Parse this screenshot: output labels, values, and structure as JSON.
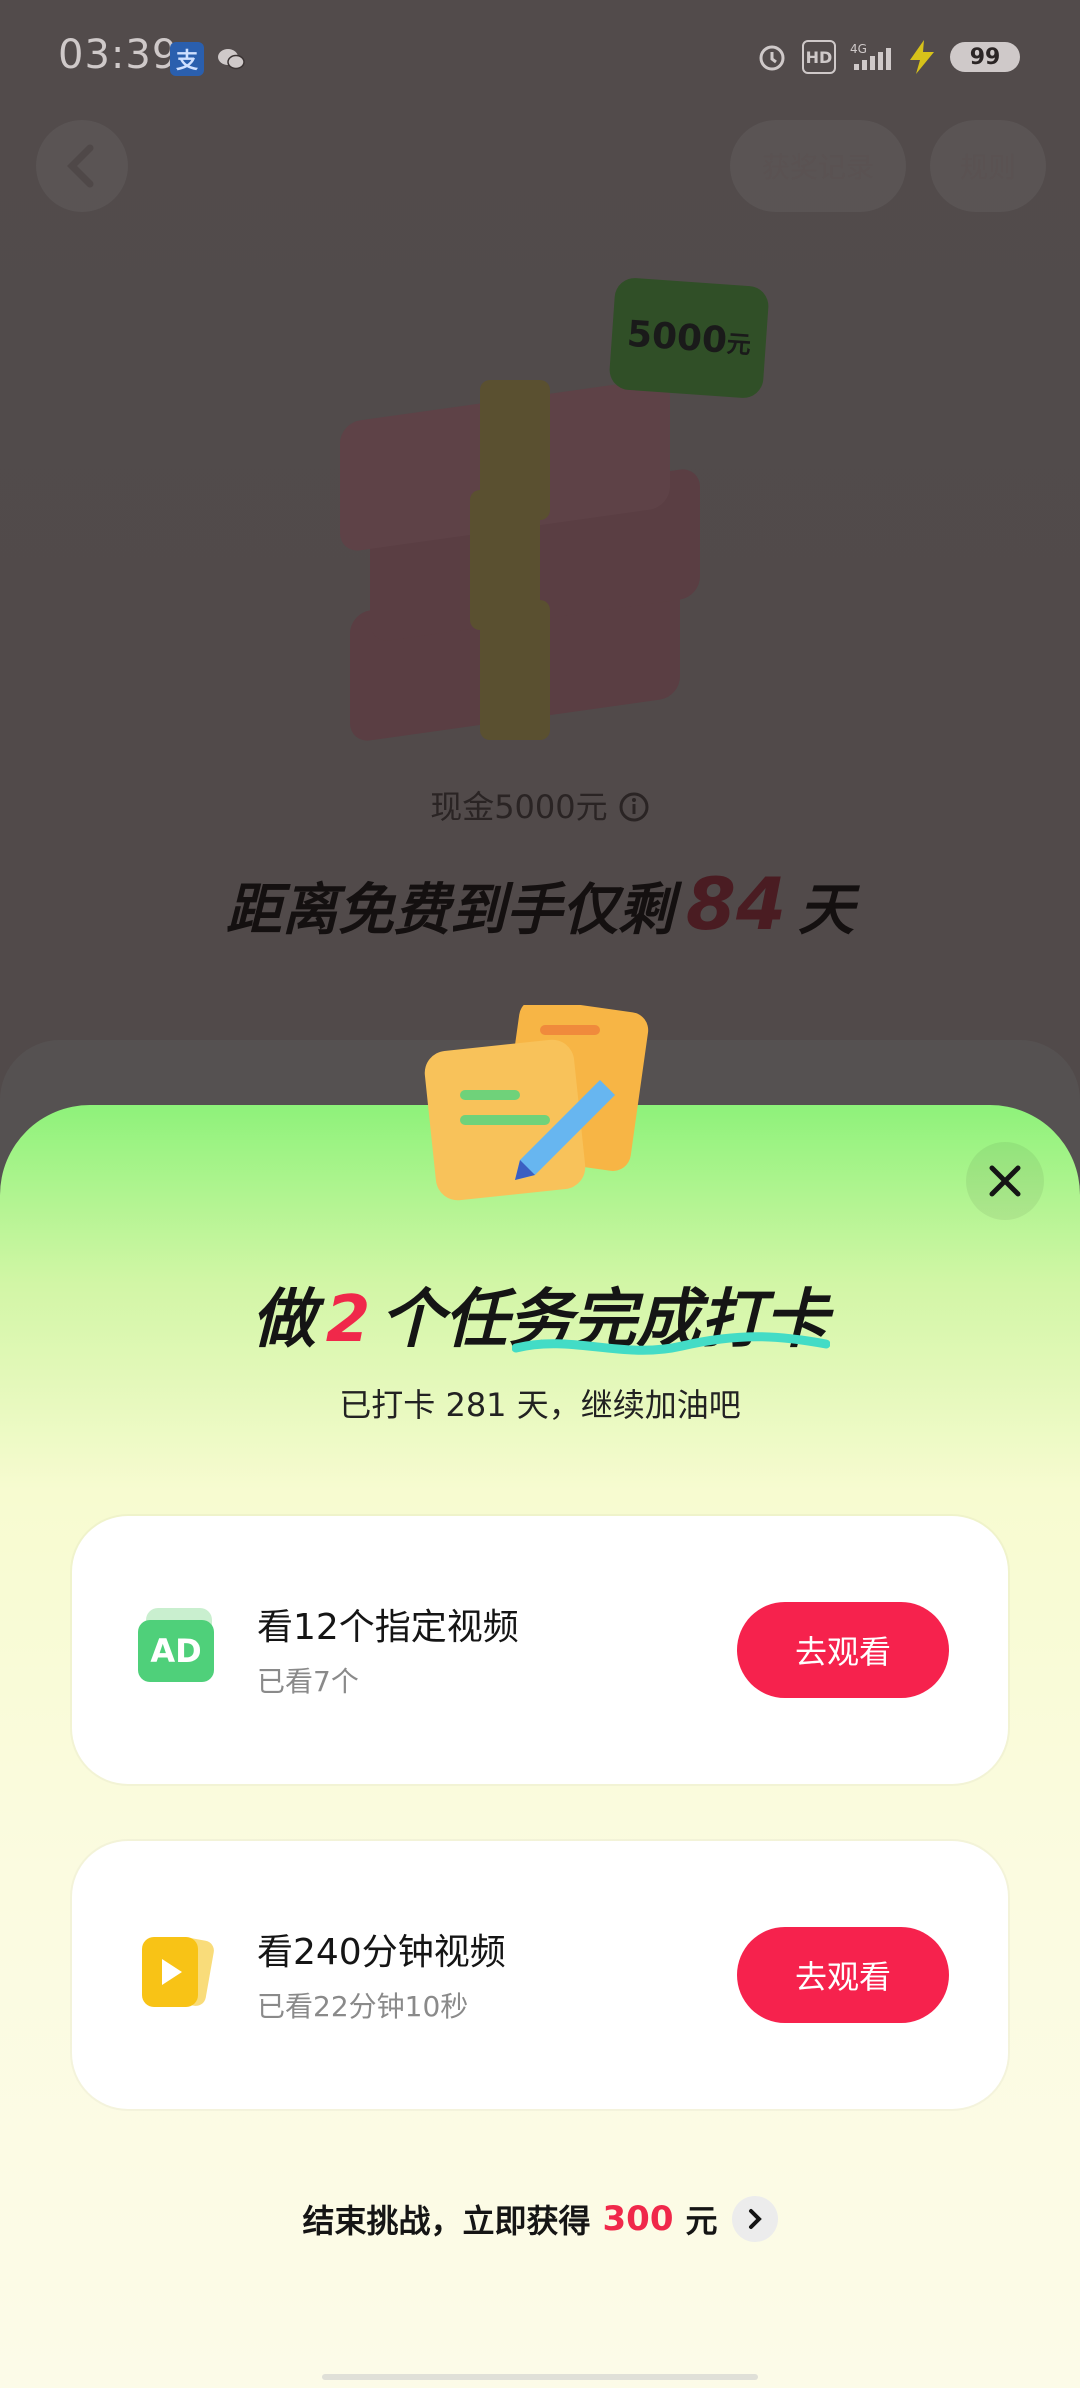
{
  "status_bar": {
    "time": "03:39",
    "battery": "99",
    "alipay_icon": "alipay-icon",
    "wechat_icon": "wechat-icon"
  },
  "header": {
    "records_label": "获奖记录",
    "rules_label": "规则"
  },
  "prize": {
    "tag": "5000",
    "tag_unit": "元",
    "cash_label": "现金5000元",
    "countdown_prefix": "距离免费到手仅剩",
    "countdown_days": "84",
    "countdown_suffix": "天"
  },
  "sheet": {
    "title_prefix": "做",
    "task_count": "2",
    "title_suffix": "个任务完成打卡",
    "subtitle": "已打卡 281 天，继续加油吧",
    "tasks": [
      {
        "icon": "ad-icon",
        "icon_text": "AD",
        "name": "看12个指定视频",
        "progress": "已看7个",
        "button": "去观看"
      },
      {
        "icon": "video-play-icon",
        "name": "看240分钟视频",
        "progress": "已看22分钟10秒",
        "button": "去观看"
      }
    ],
    "footer_prefix": "结束挑战，立即获得",
    "footer_amount": "300",
    "footer_suffix": "元"
  },
  "colors": {
    "accent_red": "#f6224d",
    "sheet_green": "#8ef27a"
  }
}
